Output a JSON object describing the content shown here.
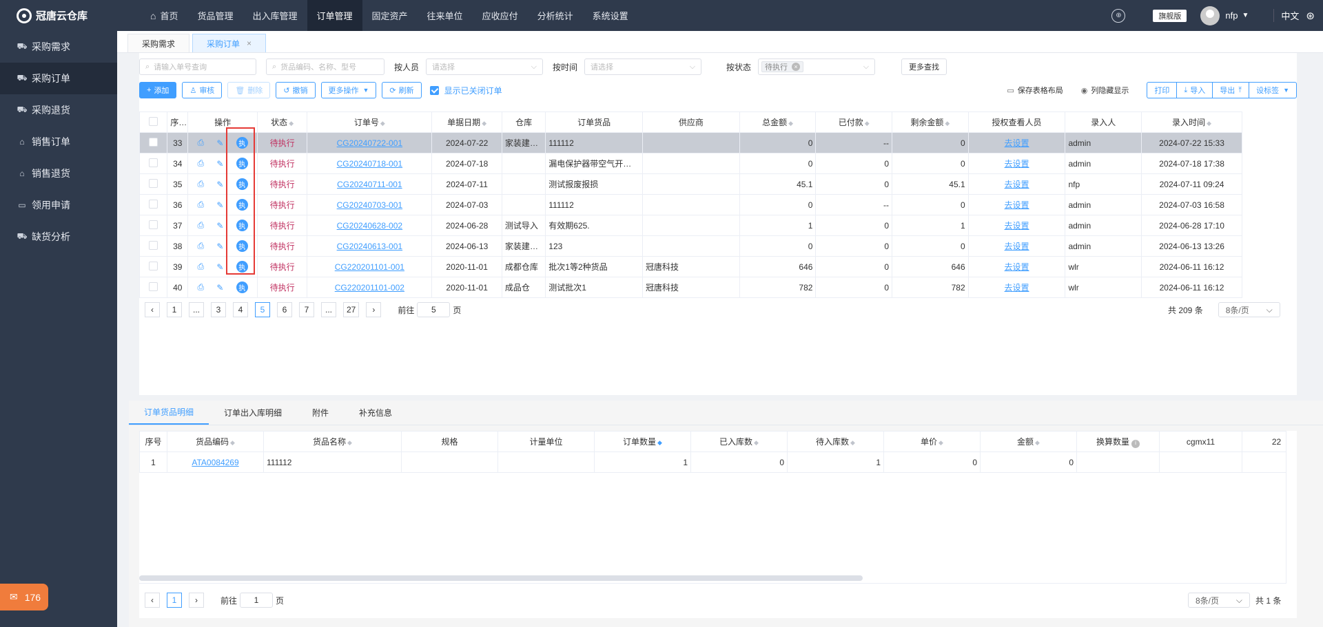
{
  "app": {
    "title": "冠唐云仓库"
  },
  "sidebar": {
    "items": [
      {
        "label": "采购需求"
      },
      {
        "label": "采购订单"
      },
      {
        "label": "采购退货"
      },
      {
        "label": "销售订单"
      },
      {
        "label": "销售退货"
      },
      {
        "label": "领用申请"
      },
      {
        "label": "缺货分析"
      }
    ]
  },
  "notify": {
    "count": "176"
  },
  "topnav": {
    "items": [
      {
        "label": "首页"
      },
      {
        "label": "货品管理"
      },
      {
        "label": "出入库管理"
      },
      {
        "label": "订单管理"
      },
      {
        "label": "固定资产"
      },
      {
        "label": "往来单位"
      },
      {
        "label": "应收应付"
      },
      {
        "label": "分析统计"
      },
      {
        "label": "系统设置"
      }
    ]
  },
  "user": {
    "edition": "旗舰版",
    "name": "nfp",
    "lang": "中文"
  },
  "pagetabs": [
    {
      "label": "采购需求"
    },
    {
      "label": "采购订单"
    }
  ],
  "filters": {
    "order_no_placeholder": "请输入单号查询",
    "goods_placeholder": "货品编码、名称、型号",
    "person_label": "按人员",
    "person_placeholder": "请选择",
    "time_label": "按时间",
    "time_placeholder": "请选择",
    "status_label": "按状态",
    "status_chip": "待执行",
    "more_search": "更多查找"
  },
  "toolbar": {
    "add": "添加",
    "audit": "审核",
    "delete": "删除",
    "revoke": "撤销",
    "more_ops": "更多操作",
    "refresh": "刷新",
    "show_closed": "显示已关闭订单",
    "save_layout": "保存表格布局",
    "col_hide": "列隐藏显示",
    "print": "打印",
    "import": "导入",
    "export": "导出",
    "set_tag": "设标签"
  },
  "orders": {
    "columns": [
      "序号",
      "操作",
      "状态",
      "订单号",
      "单据日期",
      "仓库",
      "订单货品",
      "供应商",
      "总金额",
      "已付款",
      "剩余金额",
      "授权查看人员",
      "录入人",
      "录入时间"
    ],
    "exec_icon": "执",
    "rows": [
      {
        "seq": "33",
        "status": "待执行",
        "no": "CG20240722-001",
        "date": "2024-07-22",
        "wh": "家装建材上",
        "goods": "111112",
        "supplier": "",
        "total": "0",
        "paid": "--",
        "remain": "0",
        "auth": "去设置",
        "by": "admin",
        "time": "2024-07-22 15:33"
      },
      {
        "seq": "34",
        "status": "待执行",
        "no": "CG20240718-001",
        "date": "2024-07-18",
        "wh": "",
        "goods": "漏电保护器带空气开关等",
        "supplier": "",
        "total": "0",
        "paid": "0",
        "remain": "0",
        "auth": "去设置",
        "by": "admin",
        "time": "2024-07-18 17:38"
      },
      {
        "seq": "35",
        "status": "待执行",
        "no": "CG20240711-001",
        "date": "2024-07-11",
        "wh": "",
        "goods": "测试报废报损",
        "supplier": "",
        "total": "45.1",
        "paid": "0",
        "remain": "45.1",
        "auth": "去设置",
        "by": "nfp",
        "time": "2024-07-11 09:24"
      },
      {
        "seq": "36",
        "status": "待执行",
        "no": "CG20240703-001",
        "date": "2024-07-03",
        "wh": "",
        "goods": "111112",
        "supplier": "",
        "total": "0",
        "paid": "--",
        "remain": "0",
        "auth": "去设置",
        "by": "admin",
        "time": "2024-07-03 16:58"
      },
      {
        "seq": "37",
        "status": "待执行",
        "no": "CG20240628-002",
        "date": "2024-06-28",
        "wh": "测试导入",
        "goods": "有效期625.",
        "supplier": "",
        "total": "1",
        "paid": "0",
        "remain": "1",
        "auth": "去设置",
        "by": "admin",
        "time": "2024-06-28 17:10"
      },
      {
        "seq": "38",
        "status": "待执行",
        "no": "CG20240613-001",
        "date": "2024-06-13",
        "wh": "家装建材上",
        "goods": "123",
        "supplier": "",
        "total": "0",
        "paid": "0",
        "remain": "0",
        "auth": "去设置",
        "by": "admin",
        "time": "2024-06-13 13:26"
      },
      {
        "seq": "39",
        "status": "待执行",
        "no": "CG220201101-001",
        "date": "2020-11-01",
        "wh": "成都仓库",
        "goods": "批次1等2种货品",
        "supplier": "冠唐科技",
        "total": "646",
        "paid": "0",
        "remain": "646",
        "auth": "去设置",
        "by": "wlr",
        "time": "2024-06-11 16:12"
      },
      {
        "seq": "40",
        "status": "待执行",
        "no": "CG220201101-002",
        "date": "2020-11-01",
        "wh": "成品仓",
        "goods": "测试批次1",
        "supplier": "冠唐科技",
        "total": "782",
        "paid": "0",
        "remain": "782",
        "auth": "去设置",
        "by": "wlr",
        "time": "2024-06-11 16:12"
      }
    ]
  },
  "pager1": {
    "pages": [
      "1",
      "...",
      "3",
      "4",
      "5",
      "6",
      "7",
      "...",
      "27"
    ],
    "goto_label": "前往",
    "goto_value": "5",
    "page_unit": "页",
    "total": "共 209 条",
    "size": "8条/页"
  },
  "subtabs": [
    {
      "label": "订单货品明细"
    },
    {
      "label": "订单出入库明细"
    },
    {
      "label": "附件"
    },
    {
      "label": "补充信息"
    }
  ],
  "details": {
    "columns": [
      "序号",
      "货品编码",
      "货品名称",
      "规格",
      "计量单位",
      "订单数量",
      "已入库数",
      "待入库数",
      "单价",
      "金额",
      "换算数量",
      "cgmx11",
      "22"
    ],
    "rows": [
      {
        "seq": "1",
        "code": "ATA0084269",
        "name": "111112",
        "spec": "",
        "unit": "",
        "qty": "1",
        "in": "0",
        "pending": "1",
        "price": "0",
        "amount": "0",
        "conv": "",
        "cgmx11": "",
        "c22": ""
      }
    ]
  },
  "pager2": {
    "page": "1",
    "goto_label": "前往",
    "goto_value": "1",
    "page_unit": "页",
    "size": "8条/页",
    "total": "共 1 条"
  }
}
